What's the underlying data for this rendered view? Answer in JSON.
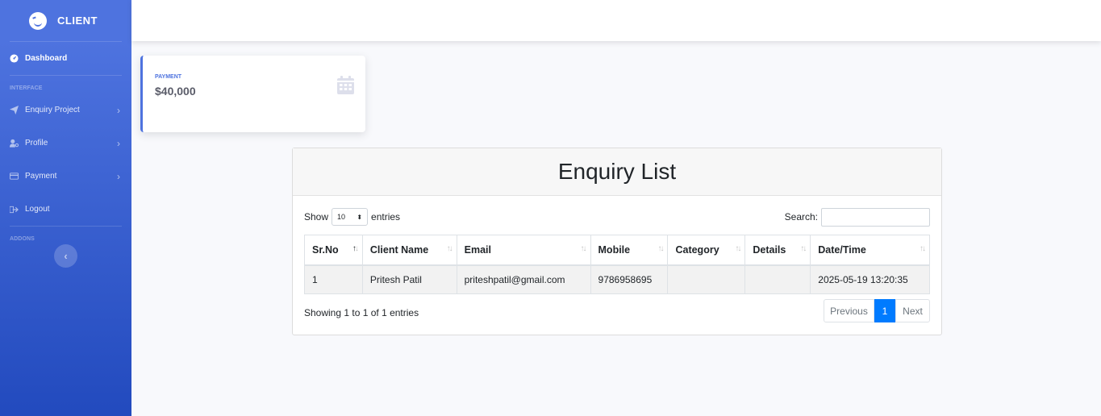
{
  "brand": {
    "name": "CLIENT",
    "icon": "laughing-face-icon"
  },
  "sidebar": {
    "dashboard": {
      "label": "Dashboard",
      "icon": "tachometer-icon"
    },
    "heading_interface": "INTERFACE",
    "items": [
      {
        "label": "Enquiry Project",
        "icon": "paper-plane-icon"
      },
      {
        "label": "Profile",
        "icon": "user-cog-icon"
      },
      {
        "label": "Payment",
        "icon": "credit-card-icon"
      },
      {
        "label": "Logout",
        "icon": "sign-out-icon"
      }
    ],
    "heading_addons": "ADDONS",
    "toggle": "‹"
  },
  "payment_card": {
    "label": "PAYMENT",
    "value": "$40,000",
    "icon": "calendar-icon"
  },
  "enquiry": {
    "title": "Enquiry List",
    "show_label": "Show",
    "page_length": "10",
    "entries_label": "entries",
    "search_label": "Search:",
    "search_value": "",
    "columns": [
      "Sr.No",
      "Client Name",
      "Email",
      "Mobile",
      "Category",
      "Details",
      "Date/Time"
    ],
    "rows": [
      [
        "1",
        "Pritesh Patil",
        "priteshpatil@gmail.com",
        "9786958695",
        "",
        "",
        "2025-05-19 13:20:35"
      ]
    ],
    "info": "Showing 1 to 1 of 1 entries",
    "pager": {
      "previous": "Previous",
      "current": "1",
      "next": "Next"
    }
  },
  "colors": {
    "sidebar": "#4e73df",
    "accent": "#007bff"
  }
}
